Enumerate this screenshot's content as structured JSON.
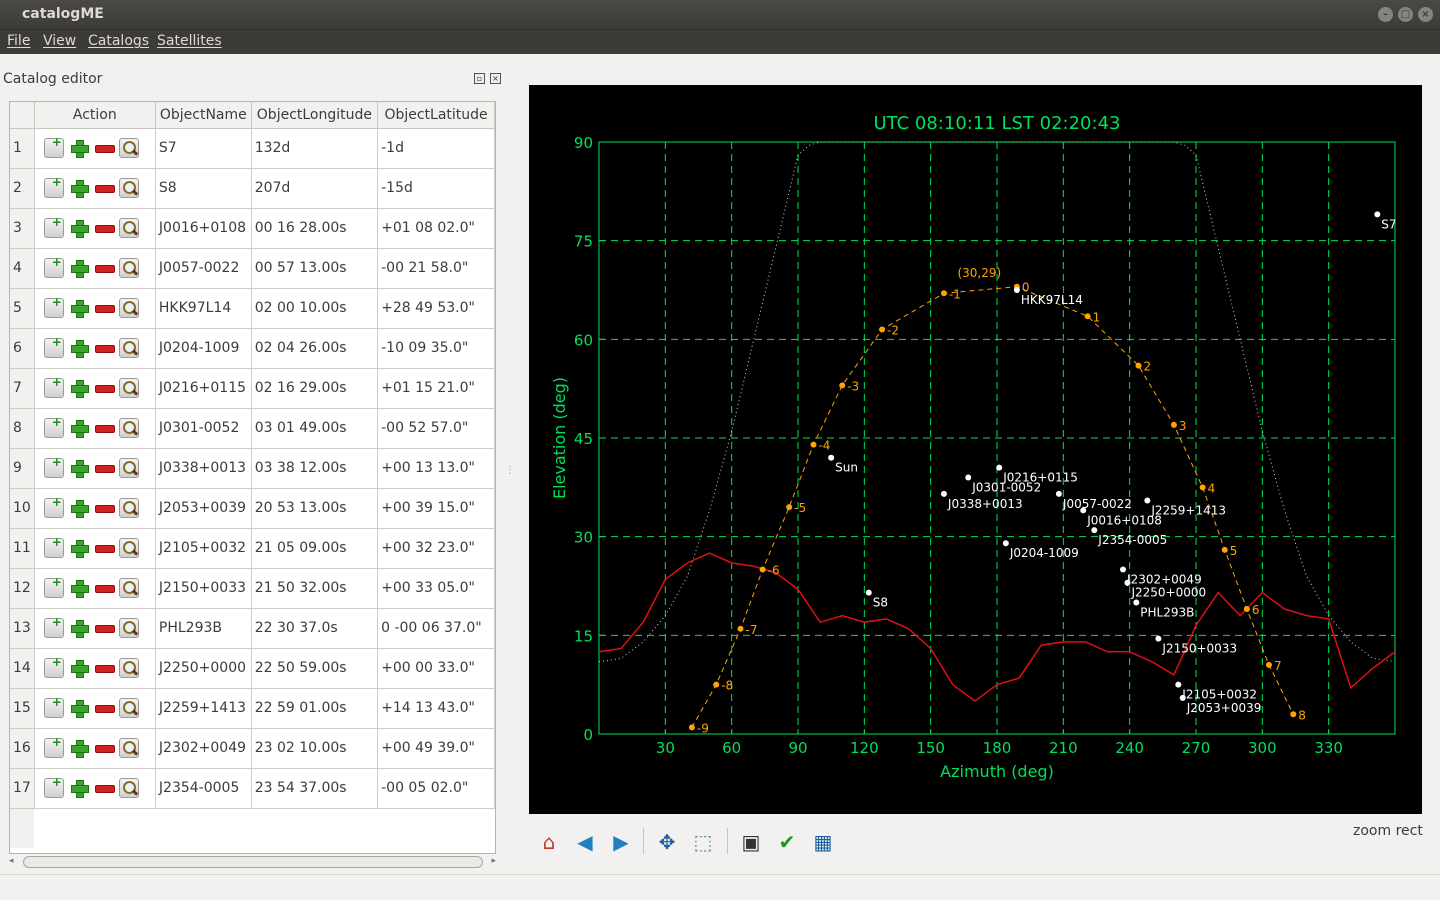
{
  "window": {
    "title": "catalogME"
  },
  "menu": [
    "File",
    "View",
    "Catalogs",
    "Satellites"
  ],
  "dock": {
    "title": "Catalog editor"
  },
  "table": {
    "columns": [
      "Action",
      "ObjectName",
      "ObjectLongitude",
      "ObjectLatitude"
    ],
    "rows": [
      {
        "num": "1",
        "name": "S7",
        "lon": "132d",
        "lat": "-1d"
      },
      {
        "num": "2",
        "name": "S8",
        "lon": "207d",
        "lat": "-15d"
      },
      {
        "num": "3",
        "name": "J0016+0108",
        "lon": "00 16 28.00s",
        "lat": "+01 08 02.0\""
      },
      {
        "num": "4",
        "name": "J0057-0022",
        "lon": "00 57 13.00s",
        "lat": "-00 21 58.0\""
      },
      {
        "num": "5",
        "name": "HKK97L14",
        "lon": "02 00 10.00s",
        "lat": "+28 49 53.0\""
      },
      {
        "num": "6",
        "name": "J0204-1009",
        "lon": "02 04 26.00s",
        "lat": "-10 09 35.0\""
      },
      {
        "num": "7",
        "name": "J0216+0115",
        "lon": "02 16 29.00s",
        "lat": "+01 15 21.0\""
      },
      {
        "num": "8",
        "name": "J0301-0052",
        "lon": "03 01 49.00s",
        "lat": "-00 52 57.0\""
      },
      {
        "num": "9",
        "name": "J0338+0013",
        "lon": "03 38 12.00s",
        "lat": "+00 13 13.0\""
      },
      {
        "num": "10",
        "name": "J2053+0039",
        "lon": "20 53 13.00s",
        "lat": "+00 39 15.0\""
      },
      {
        "num": "11",
        "name": "J2105+0032",
        "lon": "21 05 09.00s",
        "lat": "+00 32 23.0\""
      },
      {
        "num": "12",
        "name": "J2150+0033",
        "lon": "21 50 32.00s",
        "lat": "+00 33 05.0\""
      },
      {
        "num": "13",
        "name": "PHL293B",
        "lon": "22 30 37.0s",
        "lat": "0 -00 06 37.0\""
      },
      {
        "num": "14",
        "name": "J2250+0000",
        "lon": "22 50 59.00s",
        "lat": "+00 00 33.0\""
      },
      {
        "num": "15",
        "name": "J2259+1413",
        "lon": "22 59 01.00s",
        "lat": "+14 13 43.0\""
      },
      {
        "num": "16",
        "name": "J2302+0049",
        "lon": "23 02 10.00s",
        "lat": "+00 49 39.0\""
      },
      {
        "num": "17",
        "name": "J2354-0005",
        "lon": "23 54 37.00s",
        "lat": "-00 05 02.0\""
      }
    ]
  },
  "toolbar": {
    "icons": [
      "home-icon",
      "back-icon",
      "forward-icon",
      "pan-icon",
      "zoom-icon",
      "subplots-icon",
      "check-icon",
      "save-icon"
    ],
    "mode_text": "zoom rect"
  },
  "colors": {
    "axis": "#00e05a",
    "trajectory": "#ffa500",
    "horizon": "#dd1111",
    "objects": "#ffffff"
  },
  "chart_data": {
    "type": "scatter",
    "title": "UTC 08:10:11 LST 02:20:43",
    "xlabel": "Azimuth (deg)",
    "ylabel": "Elevation (deg)",
    "xlim": [
      0,
      360
    ],
    "ylim": [
      0,
      90
    ],
    "xticks": [
      30,
      60,
      90,
      120,
      150,
      180,
      210,
      240,
      270,
      300,
      330
    ],
    "yticks": [
      0,
      15,
      30,
      45,
      60,
      75,
      90
    ],
    "grid": true,
    "objects": [
      {
        "name": "S7",
        "az": 352,
        "el": 79
      },
      {
        "name": "HKK97L14",
        "az": 189,
        "el": 67.5
      },
      {
        "name": "Sun",
        "az": 105,
        "el": 42
      },
      {
        "name": "J0216+0115",
        "az": 181,
        "el": 40.5
      },
      {
        "name": "J0301-0052",
        "az": 167,
        "el": 39
      },
      {
        "name": "J0338+0013",
        "az": 156,
        "el": 36.5
      },
      {
        "name": "J0057-0022",
        "az": 208,
        "el": 36.5
      },
      {
        "name": "J2259+1413",
        "az": 248,
        "el": 35.5
      },
      {
        "name": "J0016+0108",
        "az": 219,
        "el": 34
      },
      {
        "name": "J2354-0005",
        "az": 224,
        "el": 31
      },
      {
        "name": "J0204-1009",
        "az": 184,
        "el": 29
      },
      {
        "name": "J2302+0049",
        "az": 237,
        "el": 25
      },
      {
        "name": "J2250+0000",
        "az": 239,
        "el": 23
      },
      {
        "name": "PHL293B",
        "az": 243,
        "el": 20
      },
      {
        "name": "S8",
        "az": 122,
        "el": 21.5
      },
      {
        "name": "J2150+0033",
        "az": 253,
        "el": 14.5
      },
      {
        "name": "J2105+0032",
        "az": 262,
        "el": 7.5
      },
      {
        "name": "J2053+0039",
        "az": 264,
        "el": 5.5
      }
    ],
    "trajectory": {
      "name": "HKK97L14",
      "peak_label": "(30,29)",
      "points": [
        {
          "hour": "-9",
          "az": 42,
          "el": 1
        },
        {
          "hour": "-8",
          "az": 53,
          "el": 7.5
        },
        {
          "hour": "-7",
          "az": 64,
          "el": 16
        },
        {
          "hour": "-6",
          "az": 74,
          "el": 25
        },
        {
          "hour": "-5",
          "az": 86,
          "el": 34.5
        },
        {
          "hour": "-4",
          "az": 97,
          "el": 44
        },
        {
          "hour": "-3",
          "az": 110,
          "el": 53
        },
        {
          "hour": "-2",
          "az": 128,
          "el": 61.5
        },
        {
          "hour": "-1",
          "az": 156,
          "el": 67
        },
        {
          "hour": "0",
          "az": 189,
          "el": 68
        },
        {
          "hour": "1",
          "az": 221,
          "el": 63.5
        },
        {
          "hour": "2",
          "az": 244,
          "el": 56
        },
        {
          "hour": "3",
          "az": 260,
          "el": 47
        },
        {
          "hour": "4",
          "az": 273,
          "el": 37.5
        },
        {
          "hour": "5",
          "az": 283,
          "el": 28
        },
        {
          "hour": "6",
          "az": 293,
          "el": 19
        },
        {
          "hour": "7",
          "az": 303,
          "el": 10.5
        },
        {
          "hour": "8",
          "az": 314,
          "el": 3
        }
      ]
    },
    "horizon": {
      "az": [
        0,
        10,
        20,
        30,
        40,
        50,
        60,
        70,
        80,
        90,
        100,
        110,
        120,
        130,
        140,
        150,
        160,
        170,
        180,
        190,
        200,
        210,
        220,
        230,
        240,
        250,
        260,
        270,
        280,
        290,
        300,
        310,
        320,
        330,
        340,
        350,
        360
      ],
      "el": [
        12.5,
        13,
        17,
        23.5,
        26,
        27.5,
        26,
        25.5,
        24.5,
        22,
        17,
        18,
        17,
        17.5,
        16,
        13,
        7.5,
        5,
        7.5,
        8.5,
        13.5,
        14,
        14,
        12.5,
        12.5,
        11,
        9,
        16.5,
        21.5,
        18,
        21.5,
        19,
        18,
        17.5,
        7,
        10,
        12.5
      ]
    },
    "pointing_limit": {
      "az": [
        0,
        10,
        20,
        30,
        40,
        50,
        60,
        70,
        80,
        90,
        95,
        100,
        110,
        120,
        180,
        240,
        260,
        265,
        270,
        280,
        290,
        300,
        310,
        320,
        330,
        340,
        350,
        360
      ],
      "el": [
        11,
        11.5,
        14,
        18,
        24,
        34,
        46,
        60,
        74,
        88,
        89.5,
        90,
        90,
        90,
        90,
        90,
        90,
        89.5,
        88,
        74,
        60,
        46,
        34,
        24,
        18,
        14,
        11.5,
        11
      ]
    }
  }
}
